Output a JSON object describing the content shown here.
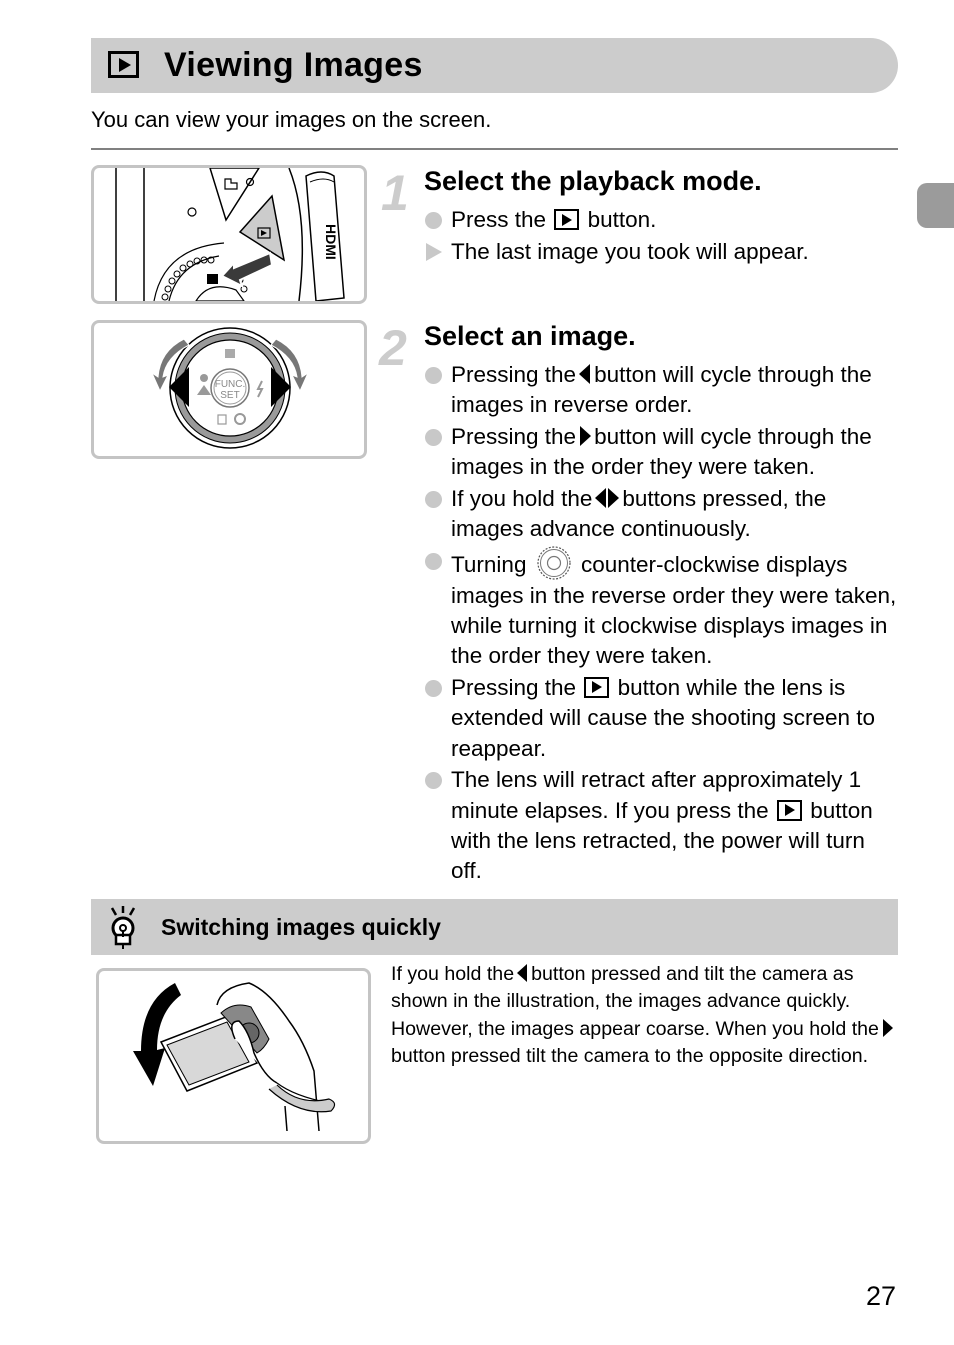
{
  "header": {
    "title_icon": "playback-icon",
    "title": "Viewing Images",
    "intro": "You can view your images on the screen."
  },
  "figures": {
    "fig1": {
      "icon": "camera-playback-button-illustration",
      "hdmi_label": "HDMI"
    },
    "fig2": {
      "icon": "control-dial-illustration",
      "center_line1": "FUNC.",
      "center_line2": "SET"
    },
    "fig3": {
      "icon": "hand-tilting-camera-illustration"
    }
  },
  "steps": [
    {
      "number": "1",
      "title": "Select the playback mode.",
      "bullets": [
        {
          "type": "action",
          "before": "Press the",
          "icon": "playback-icon",
          "after": "button."
        },
        {
          "type": "result",
          "text": "The last image you took will appear."
        }
      ]
    },
    {
      "number": "2",
      "title": "Select an image.",
      "bullets": [
        {
          "type": "action",
          "before": "Pressing the",
          "icon": "left-arrow-icon",
          "after": "button will cycle through the images in reverse order."
        },
        {
          "type": "action",
          "before": "Pressing the",
          "icon": "right-arrow-icon",
          "after": "button will cycle through the images in the order they were taken."
        },
        {
          "type": "action",
          "before": "If you hold the",
          "icon": "left-right-arrows-icon",
          "after": "buttons pressed, the images advance continuously."
        },
        {
          "type": "action",
          "before": "Turning",
          "icon": "control-dial-icon",
          "after": "counter-clockwise displays images in the reverse order they were taken, while turning it clockwise displays images in the order they were taken."
        },
        {
          "type": "action",
          "before": "Pressing the",
          "icon": "playback-icon",
          "after": "button while the lens is extended will cause the shooting screen to reappear."
        },
        {
          "type": "action",
          "before": "The lens will retract after approximately 1 minute elapses. If you press the",
          "icon": "playback-icon",
          "after": "button with the lens retracted, the power will turn off."
        }
      ]
    }
  ],
  "tip": {
    "icon": "lightbulb-tip-icon",
    "title": "Switching images quickly",
    "body_part1": "If you hold the",
    "body_icon1": "left-arrow-icon",
    "body_part2": "button pressed and tilt the camera as shown in the illustration, the images advance quickly. However, the images appear coarse. When you hold the",
    "body_icon2": "right-arrow-icon",
    "body_part3": "button pressed tilt the camera to the opposite direction."
  },
  "page_number": "27",
  "colors": {
    "title_bar": "#cccccc",
    "side_tab": "#9b9b9b",
    "bullet": "#c8c8c8",
    "step_number": "#cccccc",
    "rule": "#808080"
  }
}
